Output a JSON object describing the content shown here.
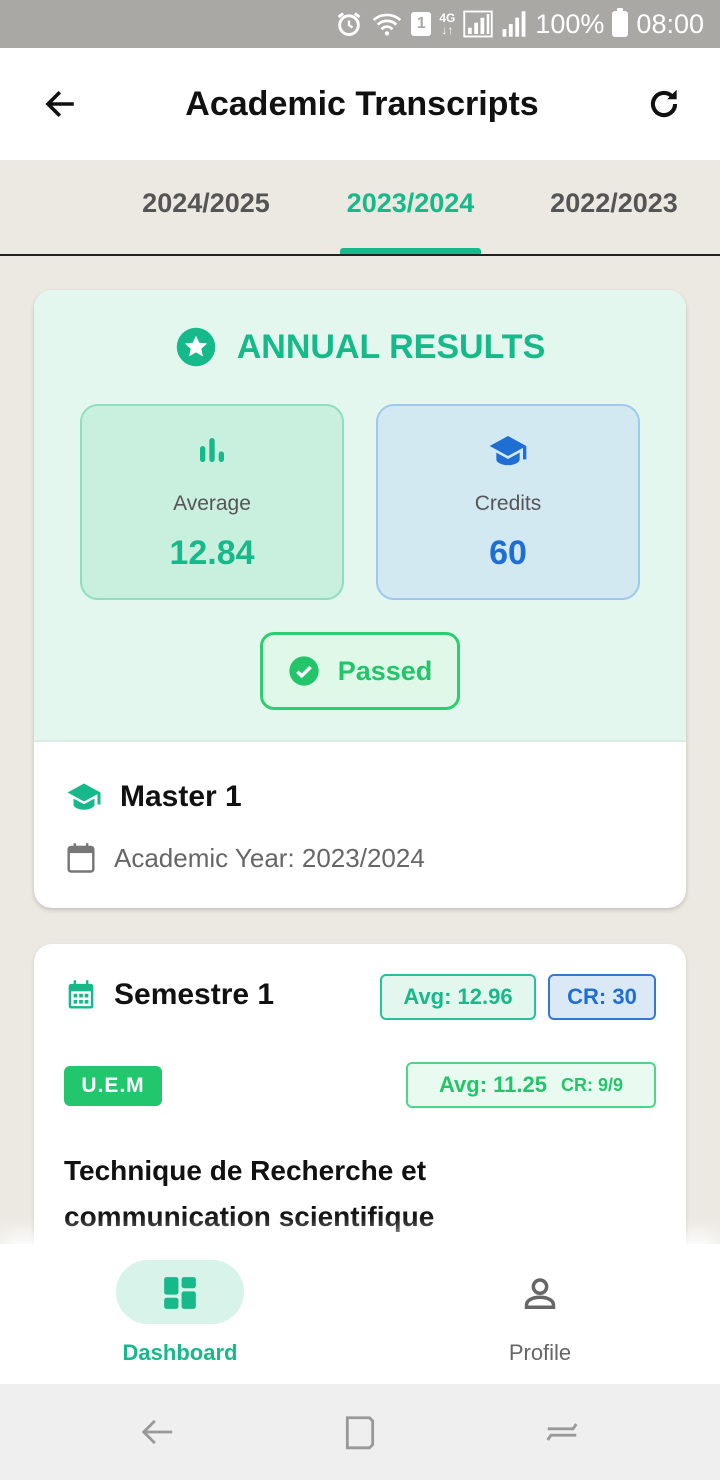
{
  "status_bar": {
    "battery": "100%",
    "time": "08:00",
    "sim_slot": "1",
    "network": "4G"
  },
  "app_bar": {
    "title": "Academic Transcripts"
  },
  "tabs": [
    {
      "label": "2024/2025"
    },
    {
      "label": "2023/2024"
    },
    {
      "label": "2022/2023"
    }
  ],
  "annual": {
    "title": "ANNUAL RESULTS",
    "average_label": "Average",
    "average_value": "12.84",
    "credits_label": "Credits",
    "credits_value": "60",
    "status": "Passed",
    "level": "Master 1",
    "academic_year": "Academic Year: 2023/2024"
  },
  "semester": {
    "title": "Semestre 1",
    "avg": "Avg: 12.96",
    "cr": "CR: 30",
    "unit": {
      "code": "U.E.M",
      "avg": "Avg: 11.25",
      "cr": "CR: 9/9",
      "module": "Technique de Recherche et communication scientifique"
    }
  },
  "bottom_nav": [
    {
      "label": "Dashboard"
    },
    {
      "label": "Profile"
    }
  ],
  "colors": {
    "accent": "#16b989",
    "blue": "#1f6ed4",
    "passed": "#22c56a",
    "background": "#ece9e2"
  }
}
